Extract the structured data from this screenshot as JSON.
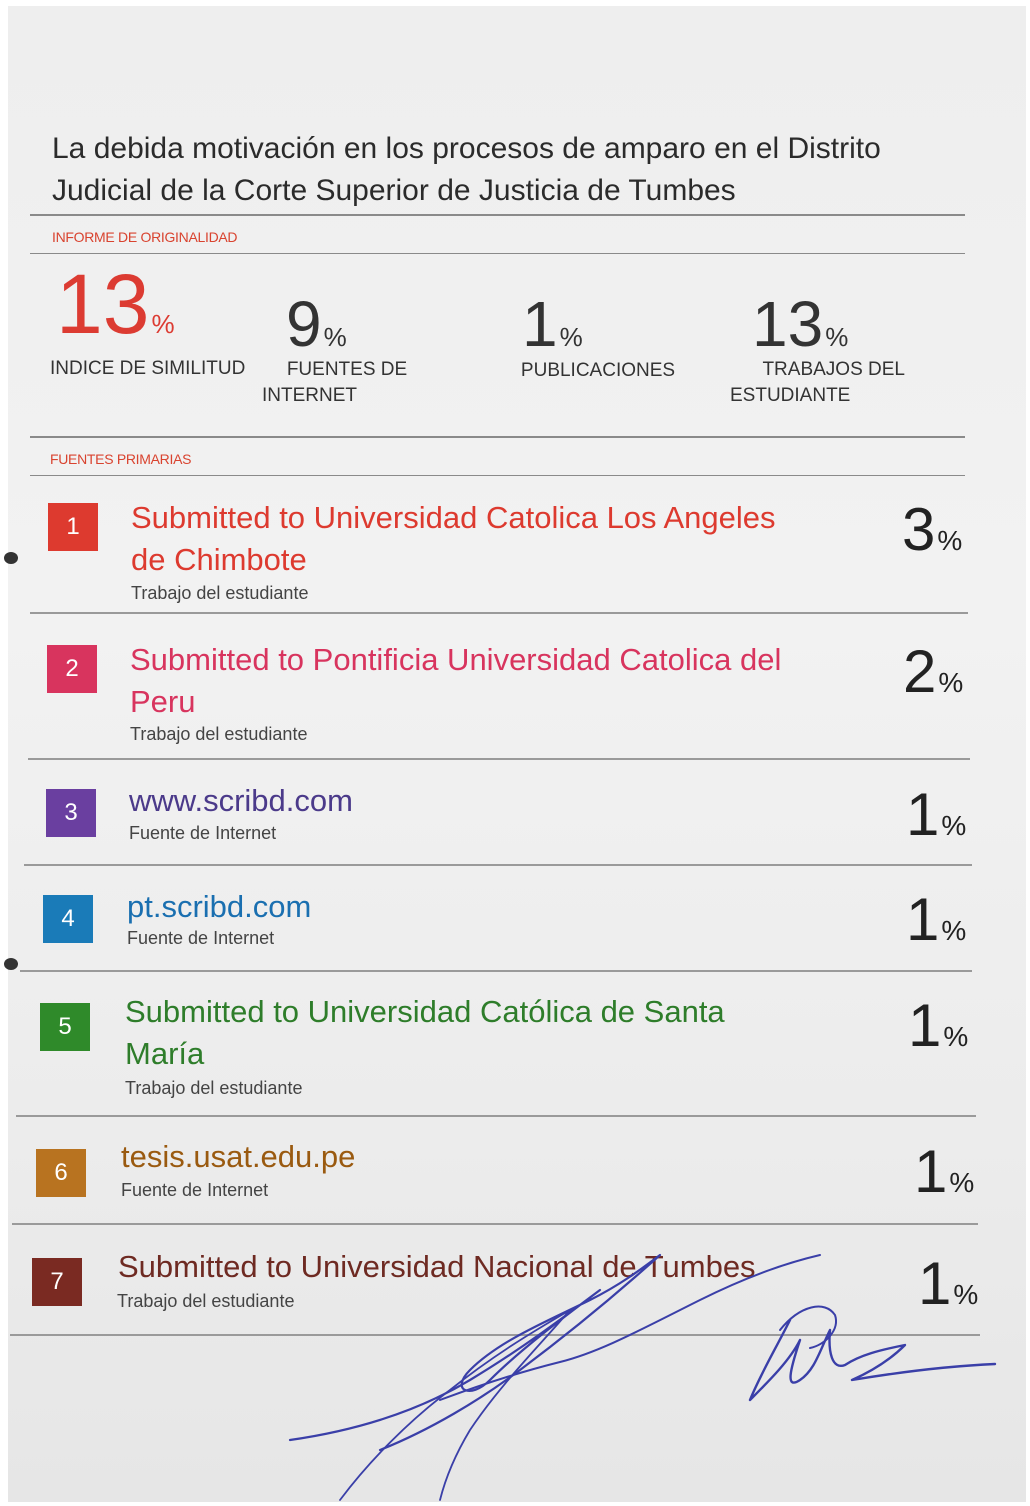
{
  "report": {
    "title_line1": "La debida motivación en los procesos de amparo en el Distrito",
    "title_line2": "Judicial de la Corte Superior de Justicia de Tumbes",
    "originality_label": "INFORME DE ORIGINALIDAD",
    "primary_sources_label": "FUENTES PRIMARIAS"
  },
  "stats": [
    {
      "value": "13",
      "unit": "%",
      "label_line1": "INDICE DE SIMILITUD",
      "label_line2": ""
    },
    {
      "value": "9",
      "unit": "%",
      "label_line1": "FUENTES DE",
      "label_line2": "INTERNET"
    },
    {
      "value": "1",
      "unit": "%",
      "label_line1": "PUBLICACIONES",
      "label_line2": ""
    },
    {
      "value": "13",
      "unit": "%",
      "label_line1": "TRABAJOS DEL",
      "label_line2": "ESTUDIANTE"
    }
  ],
  "sources": [
    {
      "rank": "1",
      "name_line1": "Submitted to Universidad Catolica Los Angeles",
      "name_line2": "de Chimbote",
      "type": "Trabajo del estudiante",
      "percent": "3",
      "unit": "%",
      "color": "#dd3a2f"
    },
    {
      "rank": "2",
      "name_line1": "Submitted to Pontificia Universidad Catolica del",
      "name_line2": "Peru",
      "type": "Trabajo del estudiante",
      "percent": "2",
      "unit": "%",
      "color": "#d8345e"
    },
    {
      "rank": "3",
      "name_line1": "www.scribd.com",
      "name_line2": "",
      "type": "Fuente de Internet",
      "percent": "1",
      "unit": "%",
      "color": "#6a3fa0"
    },
    {
      "rank": "4",
      "name_line1": "pt.scribd.com",
      "name_line2": "",
      "type": "Fuente de Internet",
      "percent": "1",
      "unit": "%",
      "color": "#1a7bb8"
    },
    {
      "rank": "5",
      "name_line1": "Submitted to Universidad Católica de Santa",
      "name_line2": "María",
      "type": "Trabajo del estudiante",
      "percent": "1",
      "unit": "%",
      "color": "#2f8a2a"
    },
    {
      "rank": "6",
      "name_line1": "tesis.usat.edu.pe",
      "name_line2": "",
      "type": "Fuente de Internet",
      "percent": "1",
      "unit": "%",
      "color": "#b87320"
    },
    {
      "rank": "7",
      "name_line1": "Submitted to Universidad Nacional de Tumbes",
      "name_line2": "",
      "type": "Trabajo del estudiante",
      "percent": "1",
      "unit": "%",
      "color": "#7a2a22"
    }
  ],
  "signature": {
    "ink_color": "#3a3fa8"
  }
}
